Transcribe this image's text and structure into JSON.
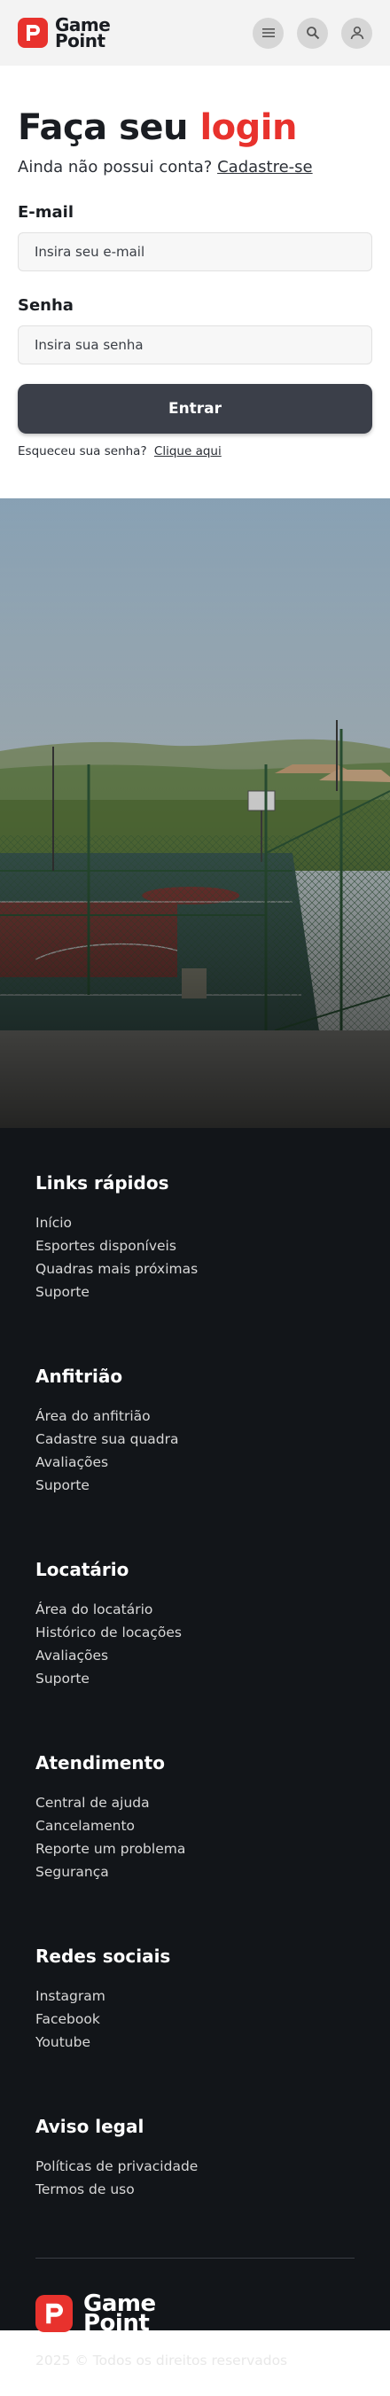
{
  "brand": {
    "line1": "Game",
    "line2": "Point",
    "accent_color": "#e8322d"
  },
  "header": {
    "icons": [
      "menu-icon",
      "search-icon",
      "user-icon"
    ]
  },
  "login": {
    "title_part1": "Faça seu",
    "title_part2": "login",
    "subtitle_text": "Ainda não possui conta?",
    "subtitle_link": "Cadastre-se",
    "email_label": "E-mail",
    "email_placeholder": "Insira seu e-mail",
    "password_label": "Senha",
    "password_placeholder": "Insira sua senha",
    "submit_label": "Entrar",
    "forgot_text": "Esqueceu sua senha?",
    "forgot_link": "Clique aqui"
  },
  "footer": {
    "sections": [
      {
        "title": "Links rápidos",
        "items": [
          "Início",
          "Esportes disponíveis",
          "Quadras mais próximas",
          "Suporte"
        ]
      },
      {
        "title": "Anfitrião",
        "items": [
          "Área do anfitrião",
          "Cadastre sua quadra",
          "Avaliações",
          "Suporte"
        ]
      },
      {
        "title": "Locatário",
        "items": [
          "Área do locatário",
          "Histórico de locações",
          "Avaliações",
          "Suporte"
        ]
      },
      {
        "title": "Atendimento",
        "items": [
          "Central de ajuda",
          "Cancelamento",
          "Reporte um problema",
          "Segurança"
        ]
      },
      {
        "title": "Redes sociais",
        "items": [
          "Instagram",
          "Facebook",
          "Youtube"
        ]
      },
      {
        "title": "Aviso legal",
        "items": [
          "Políticas de privacidade",
          "Termos de uso"
        ]
      }
    ],
    "copyright": "2025 © Todos os direitos reservados"
  }
}
